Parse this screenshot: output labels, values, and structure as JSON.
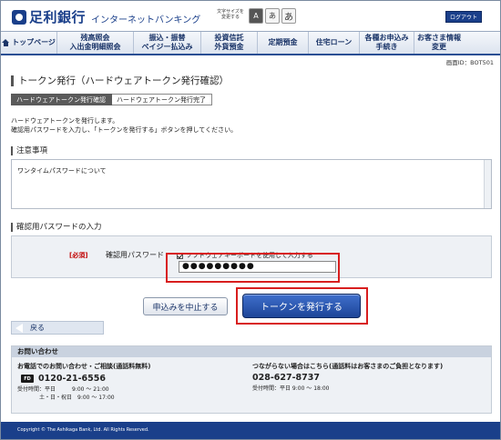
{
  "header": {
    "bank_name": "足利銀行",
    "service_name": "インターネットバンキング",
    "font_size_label": "文字サイズを変更する",
    "font_sizes": [
      "A",
      "あ",
      "あ"
    ],
    "logout_label": "ログアウト"
  },
  "nav": {
    "items": [
      {
        "label": "トップページ"
      },
      {
        "label": "残高照会\n入出金明細照会"
      },
      {
        "label": "振込・振替\nペイジー払込み"
      },
      {
        "label": "投資信託\n外貨預金"
      },
      {
        "label": "定期預金"
      },
      {
        "label": "住宅ローン"
      },
      {
        "label": "各種お申込み\n手続き"
      },
      {
        "label": "お客さま情報\n変更"
      }
    ]
  },
  "screen_id": "画面ID：BOT501",
  "page_title": "トークン発行（ハードウェアトークン発行確認）",
  "steps": {
    "current": "ハードウェアトークン発行確認",
    "next": "ハードウェアトークン発行完了"
  },
  "intro": {
    "line1": "ハードウェアトークンを発行します。",
    "line2": "確認用パスワードを入力し、「トークンを発行する」ボタンを押してください。"
  },
  "notice": {
    "heading": "注意事項",
    "text": "ワンタイムパスワードについて"
  },
  "password_section": {
    "heading": "確認用パスワードの入力",
    "required_label": "[必須]",
    "field_label": "確認用パスワード",
    "software_keyboard_label": "ソフトウェアキーボードを使用して入力する",
    "value": "●●●●●●●●●"
  },
  "buttons": {
    "cancel": "申込みを中止する",
    "issue": "トークンを発行する",
    "back": "戻る"
  },
  "contact": {
    "heading": "お問い合わせ",
    "left_heading": "お電話でのお問い合わせ・ご相談(通話料無料)",
    "freedial_label": "FD",
    "tel1": "0120-21-6556",
    "hours1_line1": "受付時間：平日　　　9:00 ～ 21:00",
    "hours1_line2": "　　　　土・日・祝日　9:00 ～ 17:00",
    "right_heading": "つながらない場合はこちら(通話料はお客さまのご負担となります)",
    "tel2": "028-627-8737",
    "hours2": "受付時間：平日 9:00 ～ 18:00"
  },
  "footer": {
    "copyright": "Copyright © The Ashikaga Bank, Ltd. All Rights Reserved."
  }
}
